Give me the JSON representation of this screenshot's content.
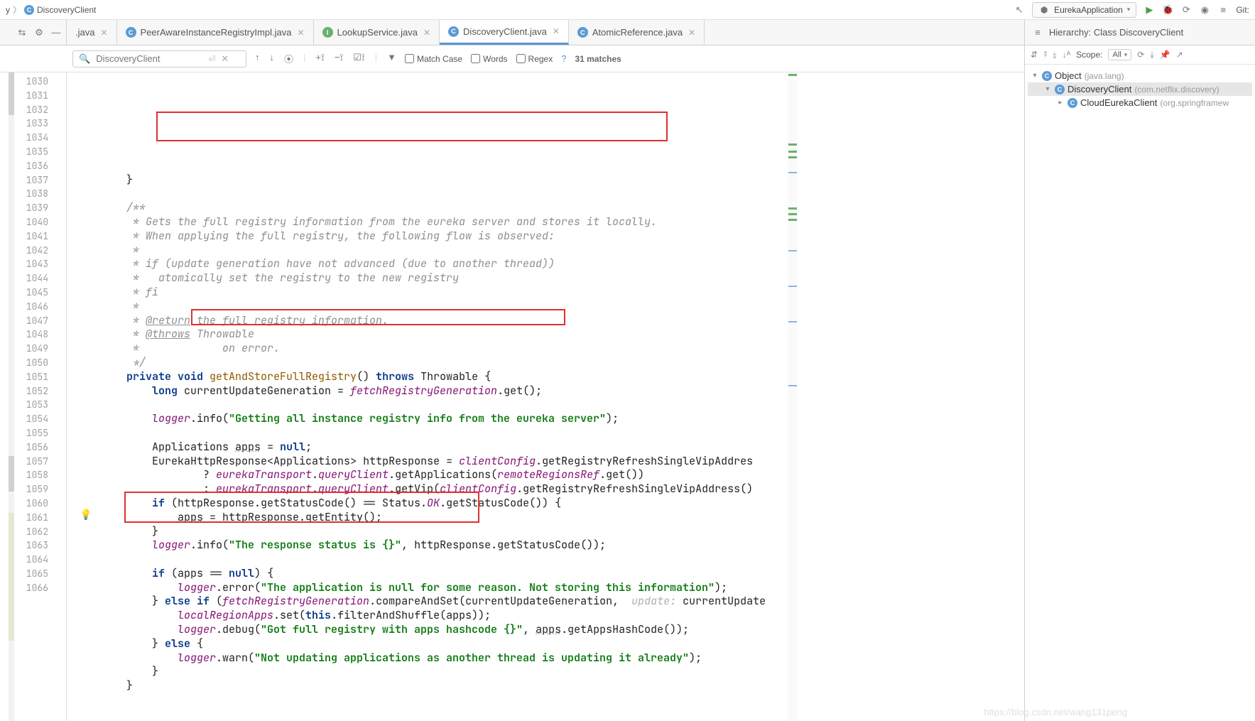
{
  "breadcrumb": {
    "last_item": "DiscoveryClient",
    "sep": "〉"
  },
  "run_config": {
    "label": "EurekaApplication"
  },
  "git_label": "Git:",
  "tabs": [
    {
      "label": ".java",
      "icon": "",
      "active": false
    },
    {
      "label": "PeerAwareInstanceRegistryImpl.java",
      "icon": "C",
      "cls": "tfc-c",
      "active": false
    },
    {
      "label": "LookupService.java",
      "icon": "I",
      "cls": "tfc-i",
      "active": false
    },
    {
      "label": "DiscoveryClient.java",
      "icon": "C",
      "cls": "tfc-c",
      "active": true
    },
    {
      "label": "AtomicReference.java",
      "icon": "C",
      "cls": "tfc-c",
      "active": false
    }
  ],
  "hierarchy_title": "Hierarchy: Class DiscoveryClient",
  "find": {
    "value": "DiscoveryClient",
    "match_case": "Match Case",
    "words": "Words",
    "regex": "Regex",
    "matches": "31 matches"
  },
  "scope": {
    "label": "Scope:",
    "value": "All"
  },
  "hierarchy": [
    {
      "level": 0,
      "exp": "▾",
      "name": "Object",
      "pkg": "(java.lang)"
    },
    {
      "level": 1,
      "exp": "▾",
      "name": "DiscoveryClient",
      "pkg": "(com.netflix.discovery)",
      "sel": true
    },
    {
      "level": 2,
      "exp": "▸",
      "name": "CloudEurekaClient",
      "pkg": "(org.springframew"
    }
  ],
  "line_start": 1030,
  "line_end": 1066,
  "code_lines": [
    "        }",
    "",
    "        <cmt>/**</cmt>",
    "<cmt>         * Gets the full registry information from the eureka server and stores it locally.</cmt>",
    "<cmt>         * When applying the full registry, the following flow is observed:</cmt>",
    "<cmt>         *</cmt>",
    "<cmt>         * if (update generation have not advanced (due to another thread))</cmt>",
    "<cmt>         *   atomically set the registry to the new registry</cmt>",
    "<cmt>         * fi</cmt>",
    "<cmt>         *</cmt>",
    "<cmt>         * </cmt><cmt-tag>@return</cmt-tag><cmt> the full registry information.</cmt>",
    "<cmt>         * </cmt><cmt-tag>@throws</cmt-tag><cmt> Throwable</cmt>",
    "<cmt>         *             on error.</cmt>",
    "<cmt>         */</cmt>",
    "        <kw>private void</kw> <mth>getAndStoreFullRegistry</mth>() <kw>throws</kw> <cls>Throwable</cls> {",
    "            <kw>long</kw> currentUpdateGeneration = <fld>fetchRegistryGeneration</fld>.get();",
    "",
    "            <fld>logger</fld>.info(<str>\"Getting all instance registry info from the eureka server\"</str>);",
    "",
    "            <cls>Applications</cls> <vname>apps</vname> = <kw>null</kw>;",
    "            <cls>EurekaHttpResponse</cls>&lt;<cls>Applications</cls>&gt; httpResponse = <fld>clientConfig</fld>.getRegistryRefreshSingleVipAddres",
    "                    ? <fld>eurekaTransport</fld>.<fld>queryClient</fld>.getApplications(<fld>remoteRegionsRef</fld>.get())",
    "                    : <fld>eurekaTransport</fld>.<fld>queryClient</fld>.getVip(<fld>clientConfig</fld>.getRegistryRefreshSingleVipAddress()",
    "            <kw>if</kw> (httpResponse.getStatusCode() == Status.<fld>OK</fld>.getStatusCode()) {",
    "                <vname>apps</vname> = httpResponse.getEntity();",
    "            }",
    "            <fld>logger</fld>.info(<str>\"The response status is {}\"</str>, httpResponse.getStatusCode());",
    "",
    "            <kw>if</kw> (apps == <kw>null</kw>) {",
    "                <fld>logger</fld>.error(<str>\"The application is null for some reason. Not storing this information\"</str>);",
    "            } <kw>else if</kw> (<fld>fetchRegistryGeneration</fld>.compareAndSet(currentUpdateGeneration,  <hint>update:</hint> currentUpdate",
    "                <fld>localRegionApps</fld>.set(<kw>this</kw>.filterAndShuffle(apps));",
    "                <fld>logger</fld>.debug(<str>\"Got full registry with apps hashcode {}\"</str>, <vname>apps</vname>.getAppsHashCode());",
    "            } <kw>else</kw> {",
    "                <fld>logger</fld>.warn(<str>\"Not updating applications as another thread is updating it already\"</str>);",
    "            }",
    "        }"
  ],
  "watermark": "https://blog.csdn.net/wang131peng"
}
